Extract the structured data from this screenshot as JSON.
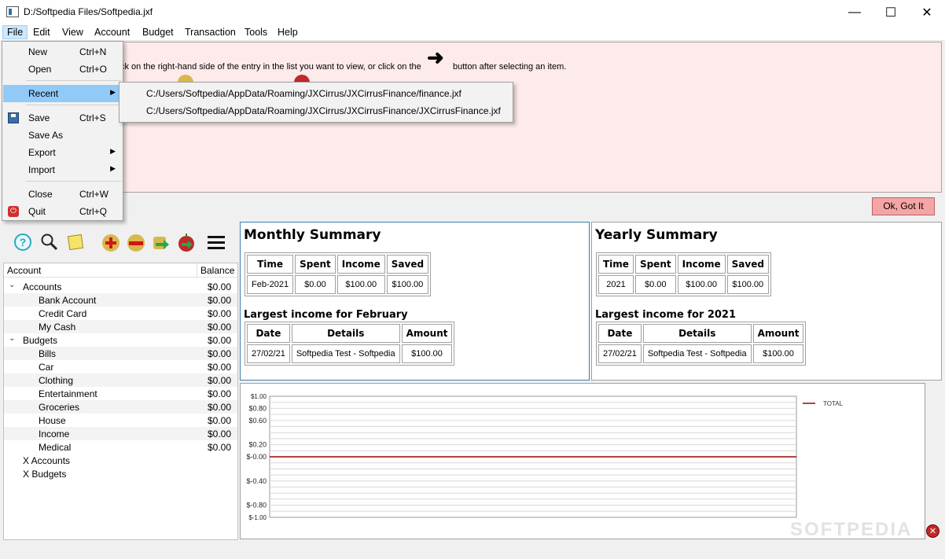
{
  "window": {
    "title": "D:/Softpedia Files/Softpedia.jxf",
    "minimize": "—",
    "maximize": "☐",
    "close": "✕"
  },
  "menubar": [
    "File",
    "Edit",
    "View",
    "Account",
    "Budget",
    "Transaction",
    "Tools",
    "Help"
  ],
  "info": {
    "text_part1": "ck on the right-hand side of the entry in the list you want to view, or click on the",
    "text_part2": "button after selecting an item.",
    "arrow": "➜",
    "ok_button": "Ok, Got It"
  },
  "toolbar": {
    "help": "?",
    "search": "⚲",
    "menu": "≡"
  },
  "tree": {
    "col_account": "Account",
    "col_balance": "Balance",
    "rows": [
      {
        "label": "Accounts",
        "balance": "$0.00",
        "level": 1,
        "group": true
      },
      {
        "label": "Bank Account",
        "balance": "$0.00",
        "level": 2
      },
      {
        "label": "Credit Card",
        "balance": "$0.00",
        "level": 2
      },
      {
        "label": "My Cash",
        "balance": "$0.00",
        "level": 2
      },
      {
        "label": "Budgets",
        "balance": "$0.00",
        "level": 1,
        "group": true
      },
      {
        "label": "Bills",
        "balance": "$0.00",
        "level": 2
      },
      {
        "label": "Car",
        "balance": "$0.00",
        "level": 2
      },
      {
        "label": "Clothing",
        "balance": "$0.00",
        "level": 2
      },
      {
        "label": "Entertainment",
        "balance": "$0.00",
        "level": 2
      },
      {
        "label": "Groceries",
        "balance": "$0.00",
        "level": 2
      },
      {
        "label": "House",
        "balance": "$0.00",
        "level": 2
      },
      {
        "label": "Income",
        "balance": "$0.00",
        "level": 2
      },
      {
        "label": "Medical",
        "balance": "$0.00",
        "level": 2
      },
      {
        "label": "X Accounts",
        "balance": "",
        "level": 1
      },
      {
        "label": "X Budgets",
        "balance": "",
        "level": 1
      }
    ]
  },
  "monthly": {
    "title": "Monthly Summary",
    "headers": [
      "Time",
      "Spent",
      "Income",
      "Saved"
    ],
    "row": [
      "Feb-2021",
      "$0.00",
      "$100.00",
      "$100.00"
    ],
    "largest_title": "Largest income for February",
    "largest_headers": [
      "Date",
      "Details",
      "Amount"
    ],
    "largest_row": [
      "27/02/21",
      "Softpedia Test - Softpedia",
      "$100.00"
    ]
  },
  "yearly": {
    "title": "Yearly Summary",
    "headers": [
      "Time",
      "Spent",
      "Income",
      "Saved"
    ],
    "row": [
      "2021",
      "$0.00",
      "$100.00",
      "$100.00"
    ],
    "largest_title": "Largest income for 2021",
    "largest_headers": [
      "Date",
      "Details",
      "Amount"
    ],
    "largest_row": [
      "27/02/21",
      "Softpedia Test - Softpedia",
      "$100.00"
    ]
  },
  "chart_data": {
    "type": "line",
    "y_ticks": [
      "$1.00",
      "$0.80",
      "$0.60",
      "$0.20",
      "$-0.00",
      "$-0.40",
      "$-0.80",
      "$-1.00"
    ],
    "ylim": [
      -1.0,
      1.0
    ],
    "series": [
      {
        "name": "TOTAL",
        "values": [
          0,
          0
        ],
        "color": "#a00000"
      }
    ],
    "legend_position": "top-right",
    "grid": true
  },
  "file_menu": {
    "items": [
      {
        "label": "New",
        "shortcut": "Ctrl+N"
      },
      {
        "label": "Open",
        "shortcut": "Ctrl+O"
      },
      {
        "label": "Recent",
        "shortcut": "",
        "submenu": true,
        "highlighted": true
      },
      {
        "label": "Save",
        "shortcut": "Ctrl+S"
      },
      {
        "label": "Save As",
        "shortcut": ""
      },
      {
        "label": "Export",
        "shortcut": "",
        "submenu": true
      },
      {
        "label": "Import",
        "shortcut": "",
        "submenu": true
      },
      {
        "label": "Close",
        "shortcut": "Ctrl+W"
      },
      {
        "label": "Quit",
        "shortcut": "Ctrl+Q"
      }
    ]
  },
  "recent_files": [
    "C:/Users/Softpedia/AppData/Roaming/JXCirrus/JXCirrusFinance/finance.jxf",
    "C:/Users/Softpedia/AppData/Roaming/JXCirrus/JXCirrusFinance/JXCirrusFinance.jxf"
  ],
  "watermark": "SOFTPEDIA",
  "colors": {
    "banner": "#fdeaea",
    "ok_button": "#f5a5a5",
    "menu_highlight": "#91c9f7",
    "chart_line": "#a00000"
  }
}
